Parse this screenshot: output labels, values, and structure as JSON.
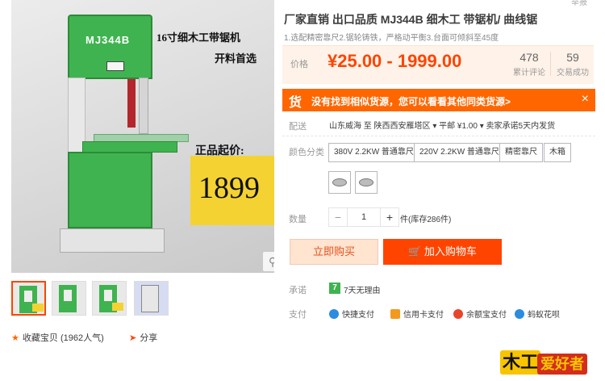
{
  "product": {
    "title": "厂家直销 出口品质 MJ344B 细木工 带锯机/ 曲线锯",
    "subtitle": "1.选配精密靠尺2.锯轮铸铁，严格动平衡3.台面可倾斜至45度",
    "corner_text": "举报"
  },
  "photo": {
    "brand": "MJ344B",
    "line1": "16寸细木工带锯机",
    "line2": "开料首选",
    "line3": "正品起价:",
    "tag_price": "1899",
    "zoom_icon": "magnifier-icon"
  },
  "thumbs": [
    {
      "style": "green",
      "active": true
    },
    {
      "style": "green",
      "active": false
    },
    {
      "style": "green",
      "active": false
    },
    {
      "style": "blue",
      "active": false
    }
  ],
  "favorites": {
    "label": "收藏宝贝",
    "count": "(1962人气)"
  },
  "share": {
    "label": "分享"
  },
  "price": {
    "label": "价格",
    "value": "¥25.00 - 1999.00",
    "reviews_count": "478",
    "reviews_label": "累计评论",
    "trades_count": "59",
    "trades_label": "交易成功"
  },
  "notice": {
    "icon": "货",
    "message": "没有找到相似货源，您可以看看其他同类货源>",
    "close": "×"
  },
  "delivery": {
    "label": "配送",
    "text": "山东威海 至  陕西西安雁塔区  ▾    平邮 ¥1.00  ▾    卖家承诺5天内发货"
  },
  "color": {
    "label": "颜色分类",
    "options": [
      "380V 2.2KW 普通靠尺",
      "220V 2.2KW 普通靠尺",
      "精密靠尺",
      "木箱"
    ]
  },
  "quantity": {
    "label": "数量",
    "minus": "−",
    "value": "1",
    "plus": "+",
    "stock": "件(库存286件)"
  },
  "buttons": {
    "buy_now": "立即购买",
    "add_cart": "加入购物车",
    "cart_icon": "cart-icon"
  },
  "promise": {
    "label": "承诺",
    "icon": "7",
    "text": "7天无理由"
  },
  "payment": {
    "label": "支付",
    "methods": [
      "快捷支付",
      "信用卡支付",
      "余额宝支付",
      "蚂蚁花呗"
    ]
  },
  "watermark": {
    "part1": "木工",
    "part2": "爱好者"
  },
  "colors": {
    "accent": "#ff4400",
    "price": "#ff4400",
    "notice_bg": "#ff6600",
    "machine_green": "#3fb34f",
    "tag_yellow": "#f4d232"
  }
}
